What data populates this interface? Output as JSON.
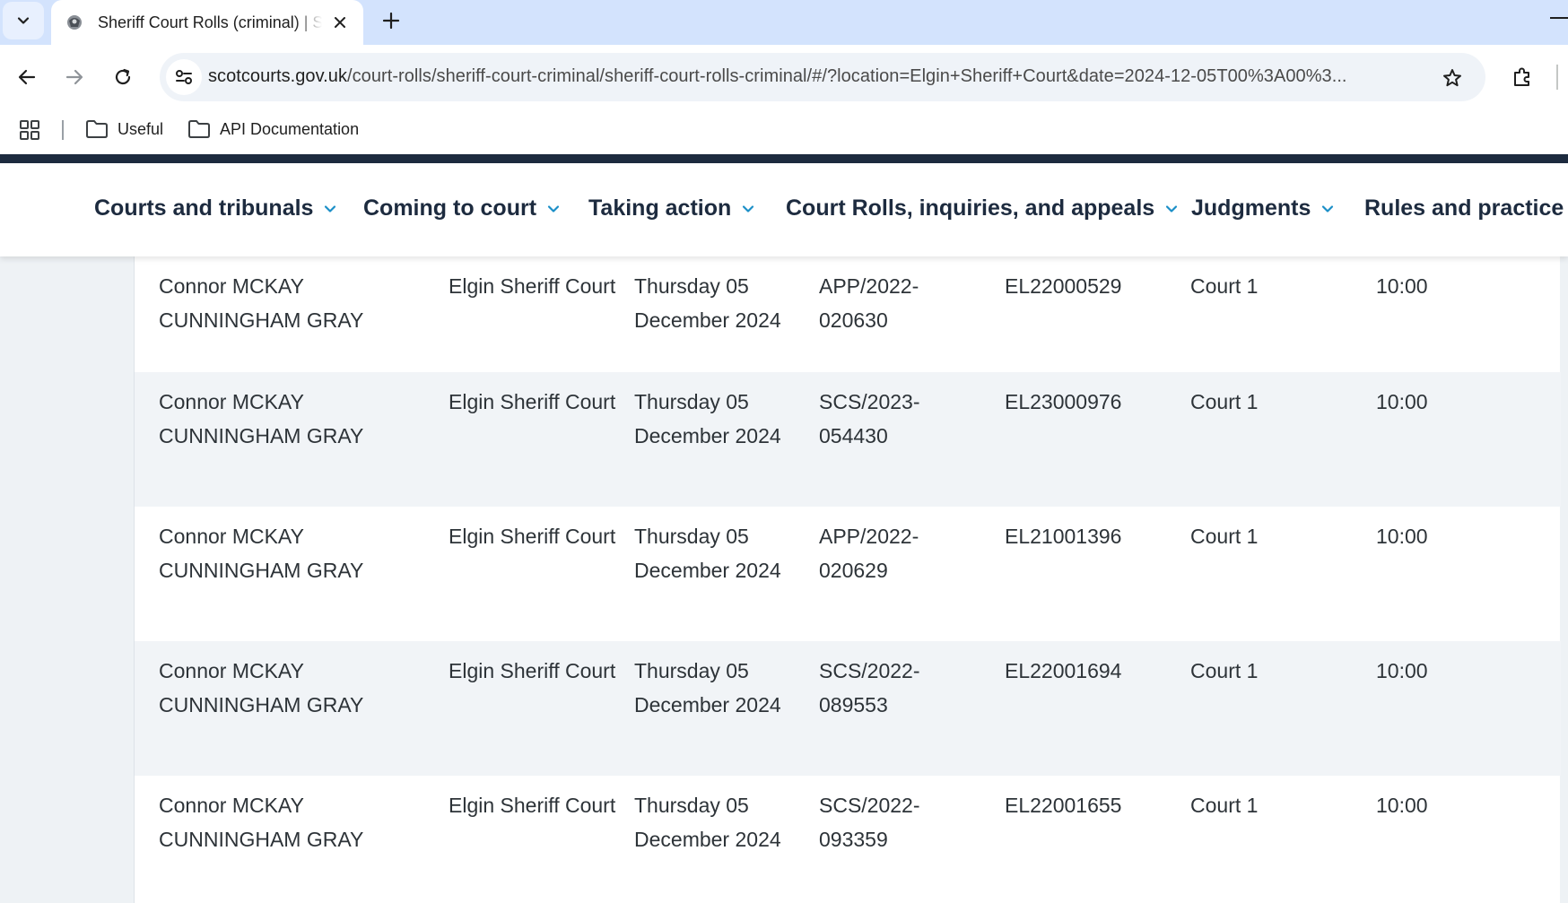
{
  "browser": {
    "tab_title": "Sheriff Court Rolls (criminal) | Scottish Courts",
    "url_host": "scotcourts.gov.uk",
    "url_path": "/court-rolls/sheriff-court-criminal/sheriff-court-rolls-criminal/#/?location=Elgin+Sheriff+Court&date=2024-12-05T00%3A00%3...",
    "bookmarks": [
      {
        "label": "Useful",
        "icon": "folder-icon"
      },
      {
        "label": "API Documentation",
        "icon": "folder-icon"
      }
    ]
  },
  "nav": {
    "items": [
      {
        "label": "Courts and tribunals"
      },
      {
        "label": "Coming to court"
      },
      {
        "label": "Taking action"
      },
      {
        "label": "Court Rolls, inquiries, and appeals"
      },
      {
        "label": "Judgments"
      },
      {
        "label": "Rules and practice"
      }
    ]
  },
  "colors": {
    "brand_navy": "#1d2b3f",
    "accent_blue": "#1b8fc7",
    "row_alt": "#f1f4f7",
    "page_bg": "#eef2f5"
  },
  "rows": [
    {
      "name": "Connor MCKAY CUNNINGHAM GRAY",
      "court": "Elgin Sheriff Court",
      "date": "Thursday 05 December 2024",
      "reference": "APP/2022-020630",
      "case_number": "EL22000529",
      "courtroom": "Court 1",
      "time": "10:00"
    },
    {
      "name": "Connor MCKAY CUNNINGHAM GRAY",
      "court": "Elgin Sheriff Court",
      "date": "Thursday 05 December 2024",
      "reference": "SCS/2023-054430",
      "case_number": "EL23000976",
      "courtroom": "Court 1",
      "time": "10:00"
    },
    {
      "name": "Connor MCKAY CUNNINGHAM GRAY",
      "court": "Elgin Sheriff Court",
      "date": "Thursday 05 December 2024",
      "reference": "APP/2022-020629",
      "case_number": "EL21001396",
      "courtroom": "Court 1",
      "time": "10:00"
    },
    {
      "name": "Connor MCKAY CUNNINGHAM GRAY",
      "court": "Elgin Sheriff Court",
      "date": "Thursday 05 December 2024",
      "reference": "SCS/2022-089553",
      "case_number": "EL22001694",
      "courtroom": "Court 1",
      "time": "10:00"
    },
    {
      "name": "Connor MCKAY CUNNINGHAM GRAY",
      "court": "Elgin Sheriff Court",
      "date": "Thursday 05 December 2024",
      "reference": "SCS/2022-093359",
      "case_number": "EL22001655",
      "courtroom": "Court 1",
      "time": "10:00"
    }
  ]
}
